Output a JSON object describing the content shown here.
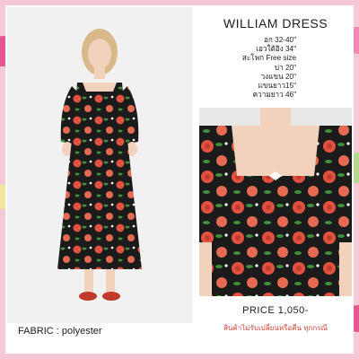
{
  "product": {
    "title": "WILLIAM DRESS",
    "specs": [
      "อก 32-40\"",
      "เอวใต้อิง 34\"",
      "สะโพก Free size",
      "บ่า 20\"",
      "วงแขน 20\"",
      "แขนยาว15\"",
      "ความยาว 46\""
    ],
    "fabric": "FABRIC : polyester",
    "price": "PRICE 1,050-",
    "note": "สินค้าไม่รับเปลี่ยนหรือคืน ทุกกรณี"
  },
  "images": {
    "model_photo": "model-wearing-floral-dress",
    "detail_photo": "floral-dress-neckline-closeup"
  },
  "colors": {
    "background": "#f6c9d6",
    "note_text": "#d0463c",
    "dress_base": "#1b1b1b",
    "flower_red": "#e0523f",
    "leaf_green": "#3f8f3a"
  }
}
